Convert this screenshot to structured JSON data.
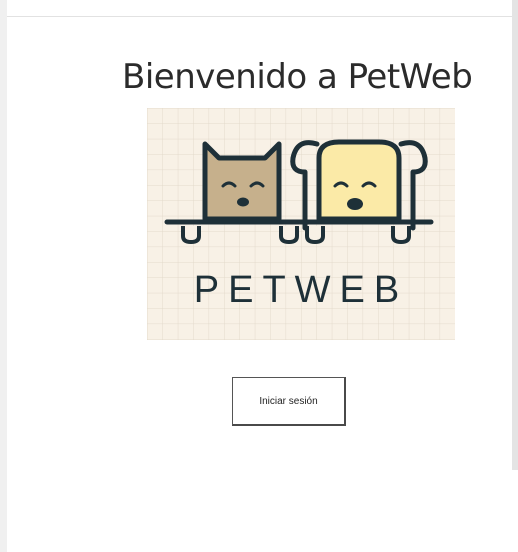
{
  "main": {
    "title": "Bienvenido a PetWeb",
    "logo": {
      "icon": "petweb-logo-icon",
      "wordmark": "PETWEB"
    },
    "login_button_label": "Iniciar sesión"
  },
  "colors": {
    "logo_background": "#f8f1e6",
    "logo_grid": "#e3dacc",
    "cat_fill": "#c6b08c",
    "dog_fill": "#fbeaa7",
    "outline": "#1e3038"
  }
}
